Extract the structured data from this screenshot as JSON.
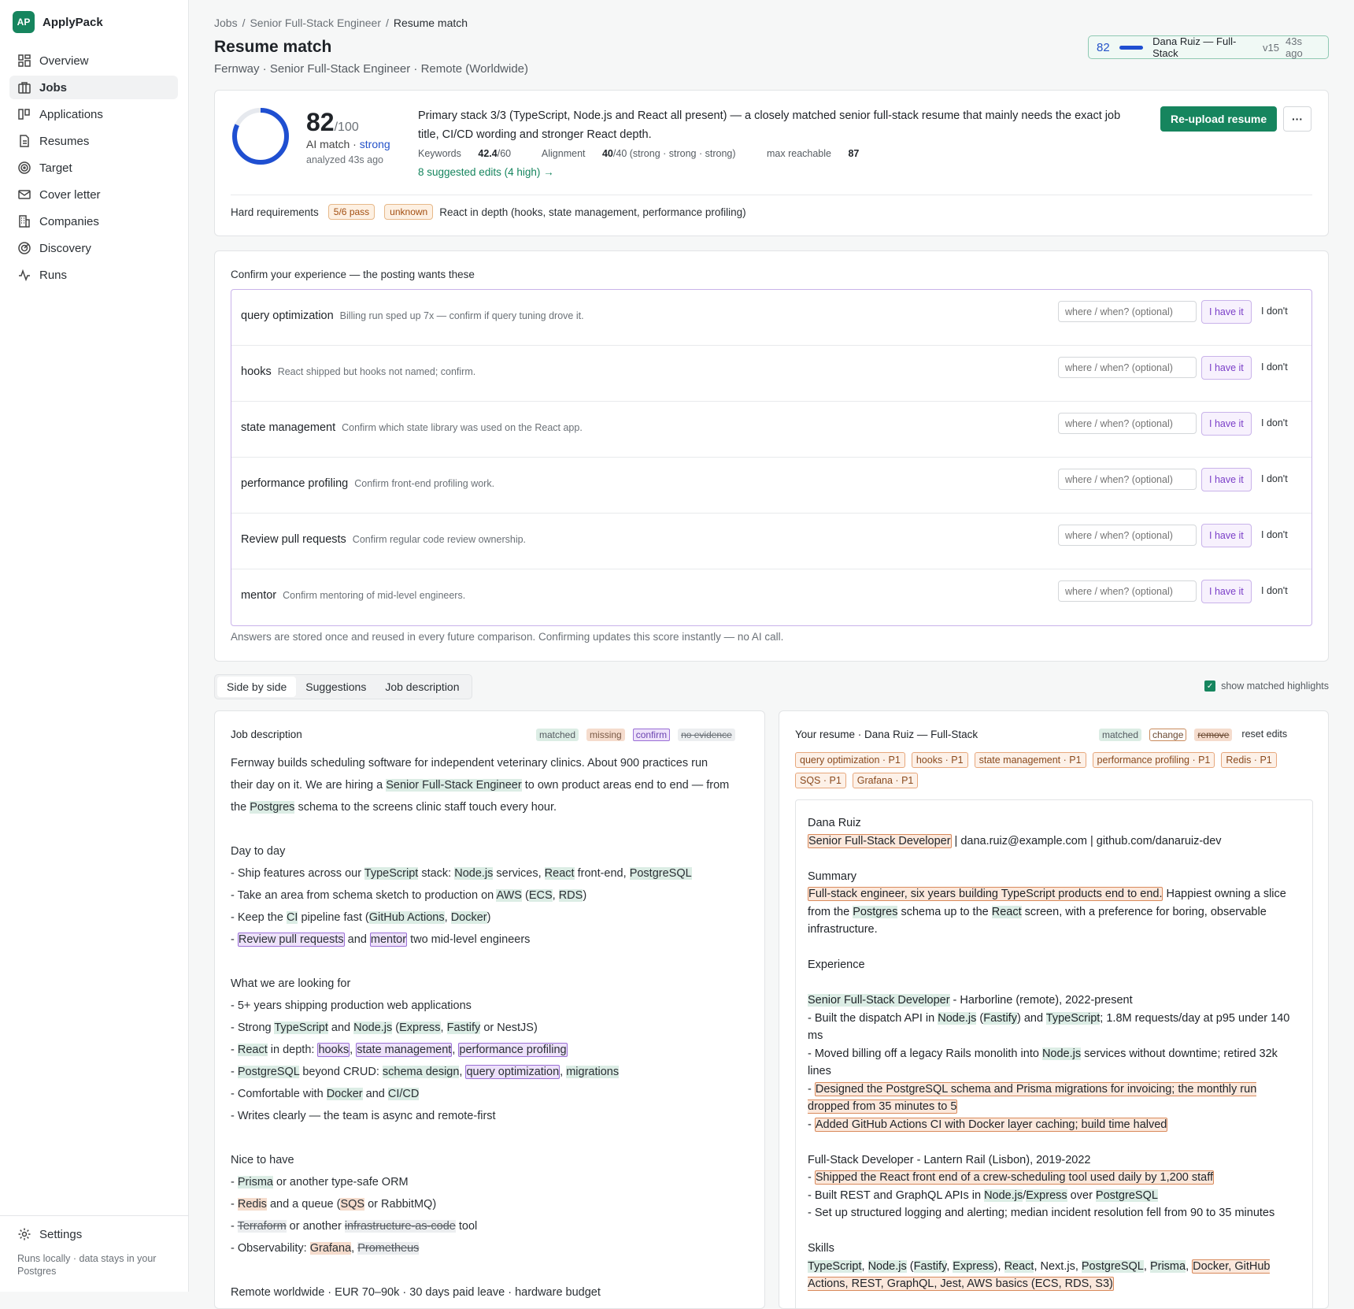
{
  "app": {
    "logo": "AP",
    "name": "ApplyPack"
  },
  "sidebar": {
    "items": [
      {
        "label": "Overview",
        "icon": "grid-icon"
      },
      {
        "label": "Jobs",
        "icon": "briefcase-icon",
        "active": true
      },
      {
        "label": "Applications",
        "icon": "kanban-icon"
      },
      {
        "label": "Resumes",
        "icon": "document-icon"
      },
      {
        "label": "Target",
        "icon": "target-icon"
      },
      {
        "label": "Cover letter",
        "icon": "mail-icon"
      },
      {
        "label": "Companies",
        "icon": "building-icon"
      },
      {
        "label": "Discovery",
        "icon": "radar-icon"
      },
      {
        "label": "Runs",
        "icon": "activity-icon"
      }
    ],
    "settings": "Settings",
    "note": "Runs locally · data stays in your Postgres"
  },
  "breadcrumb": [
    "Jobs",
    "Senior Full-Stack Engineer",
    "Resume match"
  ],
  "page": {
    "title": "Resume match",
    "subtitle": "Fernway · Senior Full-Stack Engineer · Remote (Worldwide)"
  },
  "version_pill": {
    "score": "82",
    "resume": "Dana Ruiz — Full-Stack",
    "version": "v15",
    "time": "43s ago"
  },
  "score": {
    "value": "82",
    "out_of": "/100",
    "fraction": 0.82,
    "ai_label": "AI match ·",
    "strength": "strong",
    "analyzed": "analyzed 43s ago",
    "summary": "Primary stack 3/3 (TypeScript, Node.js and React all present) — a closely matched senior full-stack resume that mainly needs the exact job title, CI/CD wording and stronger React depth.",
    "keywords_label": "Keywords",
    "keywords_value": "42.4",
    "keywords_max": "/60",
    "alignment_label": "Alignment",
    "alignment_value": "40",
    "alignment_max": "/40 (strong · strong · strong)",
    "max_label": "max reachable",
    "max_value": "87",
    "suggest_link": "8 suggested edits (4 high) →",
    "reupload": "Re-upload resume",
    "more": "···",
    "hard_req_label": "Hard requirements",
    "hard_req_pass": "5/6 pass",
    "hard_req_status": "unknown",
    "hard_req_item": "React in depth (hooks, state management, performance profiling)",
    "colors": {
      "accent": "#16855e",
      "gauge": "#1f4fd1"
    }
  },
  "confirm": {
    "title": "Confirm your experience — the posting wants these",
    "placeholder": "where / when? (optional)",
    "have": "I have it",
    "dont": "I don't",
    "rows": [
      {
        "skill": "query optimization",
        "desc": "Billing run sped up 7x — confirm if query tuning drove it."
      },
      {
        "skill": "hooks",
        "desc": "React shipped but hooks not named; confirm."
      },
      {
        "skill": "state management",
        "desc": "Confirm which state library was used on the React app."
      },
      {
        "skill": "performance profiling",
        "desc": "Confirm front-end profiling work."
      },
      {
        "skill": "Review pull requests",
        "desc": "Confirm regular code review ownership."
      },
      {
        "skill": "mentor",
        "desc": "Confirm mentoring of mid-level engineers."
      }
    ],
    "footer": "Answers are stored once and reused in every future comparison. Confirming updates this score instantly — no AI call."
  },
  "tabs": [
    "Side by side",
    "Suggestions",
    "Job description"
  ],
  "highlight_toggle": "show matched highlights",
  "jd_panel": {
    "title": "Job description",
    "legend": [
      "matched",
      "missing",
      "confirm",
      "no evidence"
    ]
  },
  "resume_panel": {
    "title": "Your resume · Dana Ruiz — Full-Stack",
    "legend": [
      "matched",
      "change",
      "remove"
    ],
    "reset": "reset edits",
    "chips": [
      "query optimization · P1",
      "hooks · P1",
      "state management · P1",
      "performance profiling · P1",
      "Redis · P1",
      "SQS · P1",
      "Grafana · P1"
    ]
  }
}
